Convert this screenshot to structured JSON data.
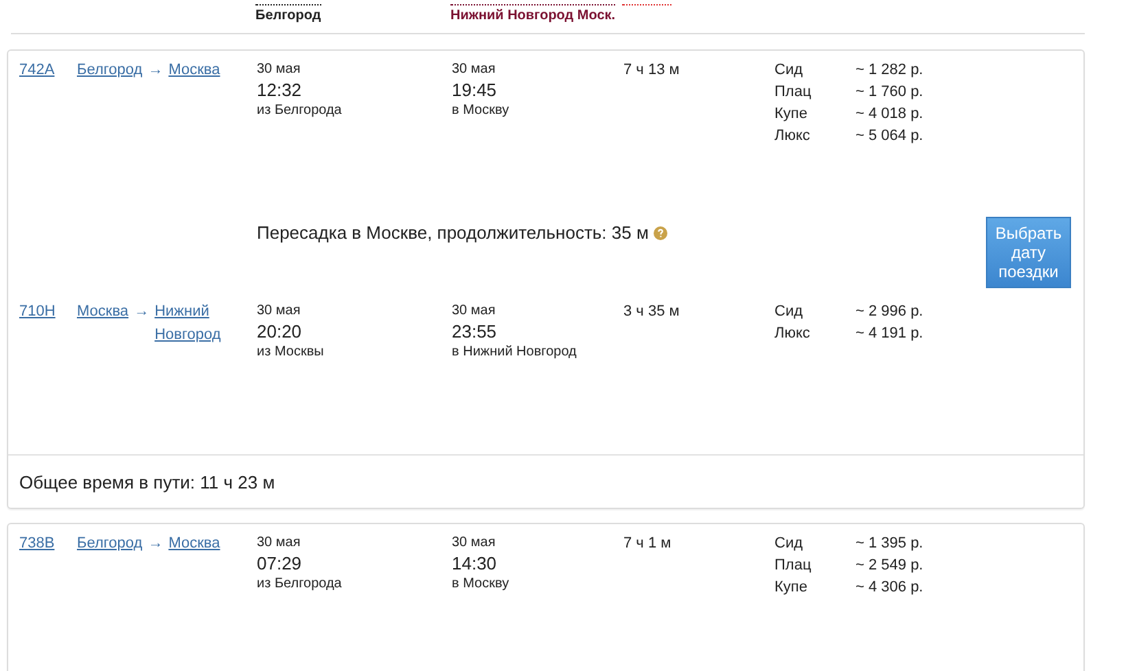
{
  "header": {
    "columns": [
      {
        "label": "Белгород",
        "color": "#222222"
      },
      {
        "label": "Нижний Новгород Моск.",
        "color": "#7a1030"
      }
    ]
  },
  "trips": [
    {
      "legs": [
        {
          "number": "742А",
          "from": "Белгород",
          "to": "Москва",
          "separator": "→",
          "departure": {
            "date": "30 мая",
            "time": "12:32",
            "place": "из Белгорода"
          },
          "arrival": {
            "date": "30 мая",
            "time": "19:45",
            "place": "в Москву"
          },
          "duration": "7 ч 13 м",
          "fares": [
            {
              "class": "Сид",
              "price": "~ 1 282 р."
            },
            {
              "class": "Плац",
              "price": "~ 1 760 р."
            },
            {
              "class": "Купе",
              "price": "~ 4 018 р."
            },
            {
              "class": "Люкс",
              "price": "~ 5 064 р."
            }
          ]
        },
        {
          "number": "710Н",
          "from": "Москва",
          "to": "Нижний Новгород",
          "separator": "→",
          "departure": {
            "date": "30 мая",
            "time": "20:20",
            "place": "из Москвы"
          },
          "arrival": {
            "date": "30 мая",
            "time": "23:55",
            "place": "в Нижний Новгород"
          },
          "duration": "3 ч 35 м",
          "fares": [
            {
              "class": "Сид",
              "price": "~ 2 996 р."
            },
            {
              "class": "Люкс",
              "price": "~ 4 191 р."
            }
          ]
        }
      ],
      "transfer": {
        "text": "Пересадка в Москве, продолжительность: 35 м",
        "button": "Выбрать дату поездки"
      },
      "total": "Общее время в пути: 11 ч 23 м"
    },
    {
      "legs": [
        {
          "number": "738В",
          "from": "Белгород",
          "to": "Москва",
          "separator": "→",
          "departure": {
            "date": "30 мая",
            "time": "07:29",
            "place": "из Белгорода"
          },
          "arrival": {
            "date": "30 мая",
            "time": "14:30",
            "place": "в Москву"
          },
          "duration": "7 ч 1 м",
          "fares": [
            {
              "class": "Сид",
              "price": "~ 1 395 р."
            },
            {
              "class": "Плац",
              "price": "~ 2 549 р."
            },
            {
              "class": "Купе",
              "price": "~ 4 306 р."
            }
          ]
        }
      ]
    }
  ]
}
